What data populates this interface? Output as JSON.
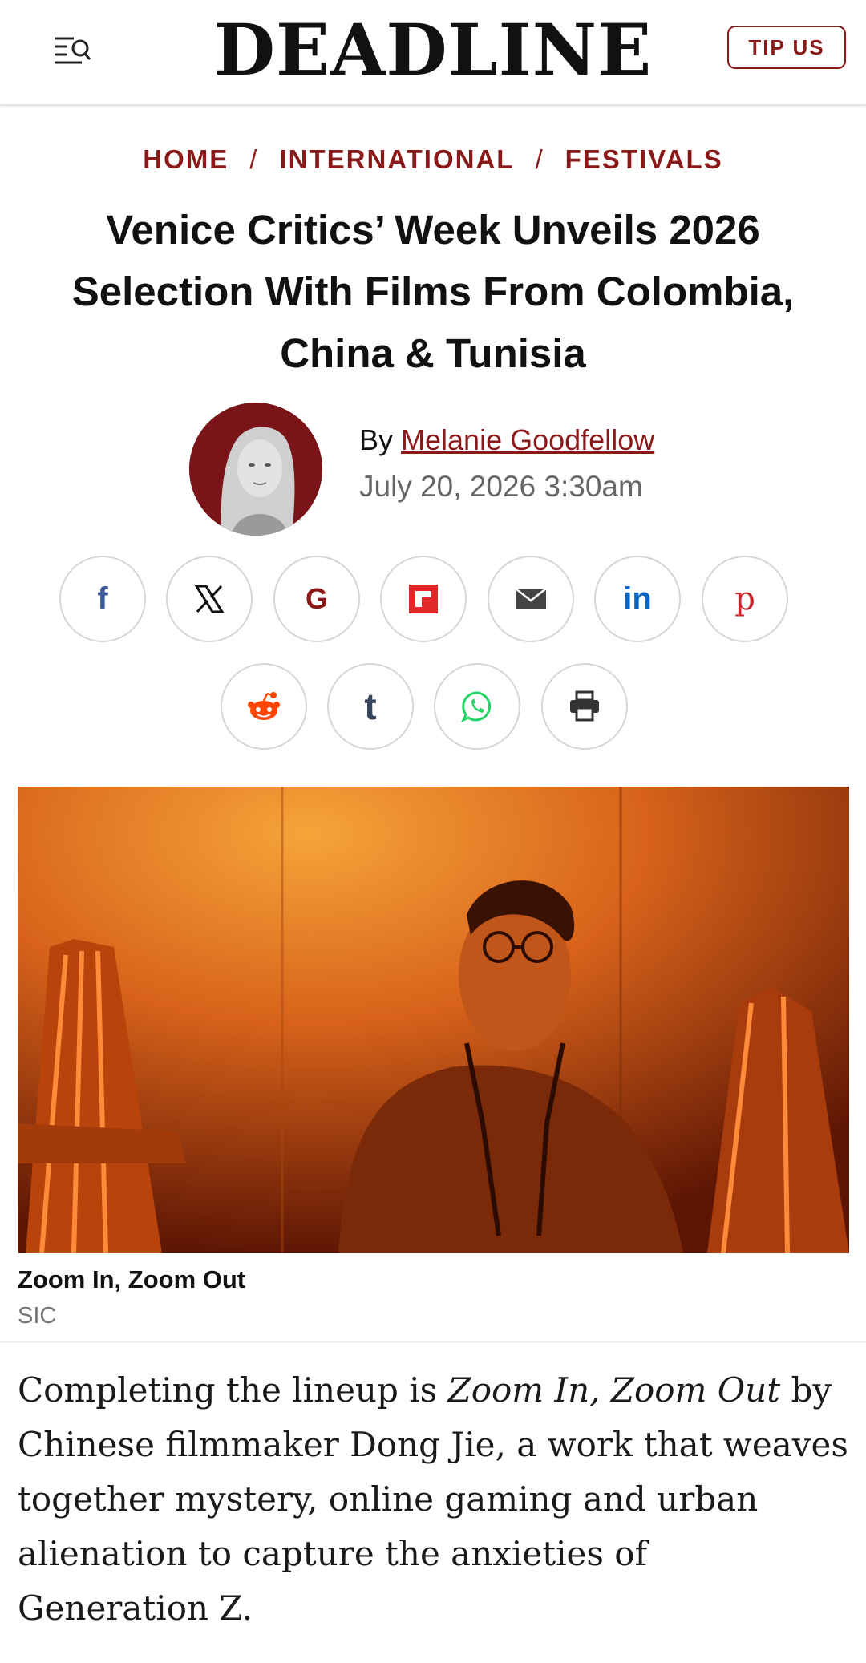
{
  "header": {
    "logo": "DEADLINE",
    "tip_button": "TIP US",
    "menu_icon": "menu-search-icon"
  },
  "breadcrumb": {
    "items": [
      "HOME",
      "INTERNATIONAL",
      "FESTIVALS"
    ],
    "separator": "/"
  },
  "article": {
    "headline": "Venice Critics’ Week Unveils 2026 Selection With Films From Colombia, China & Tunisia",
    "by_prefix": "By",
    "author": "Melanie Goodfellow",
    "date": "July 20, 2026 3:30am"
  },
  "share": {
    "icons": [
      {
        "name": "facebook-icon",
        "color": "#3b5998"
      },
      {
        "name": "x-icon",
        "color": "#111111"
      },
      {
        "name": "google-icon",
        "color": "#8a1a1a"
      },
      {
        "name": "flipboard-icon",
        "color": "#e12828"
      },
      {
        "name": "email-icon",
        "color": "#444444"
      },
      {
        "name": "linkedin-icon",
        "color": "#0a66c2"
      },
      {
        "name": "pinterest-icon",
        "color": "#c8232c"
      },
      {
        "name": "reddit-icon",
        "color": "#ff4500"
      },
      {
        "name": "tumblr-icon",
        "color": "#35465c"
      },
      {
        "name": "whatsapp-icon",
        "color": "#25d366"
      },
      {
        "name": "print-icon",
        "color": "#333333"
      }
    ]
  },
  "image": {
    "caption_title": "Zoom In, Zoom Out",
    "caption_credit": "SIC"
  },
  "body": {
    "p1_before": "Completing the lineup is ",
    "p1_title": "Zoom In, Zoom Out",
    "p1_after": " by Chinese filmmaker Dong Jie, a work that weaves together mystery, online gaming and urban alienation to capture the anxieties of Generation Z."
  },
  "colors": {
    "accent": "#8a1a1a",
    "text": "#111111",
    "muted": "#666666"
  }
}
